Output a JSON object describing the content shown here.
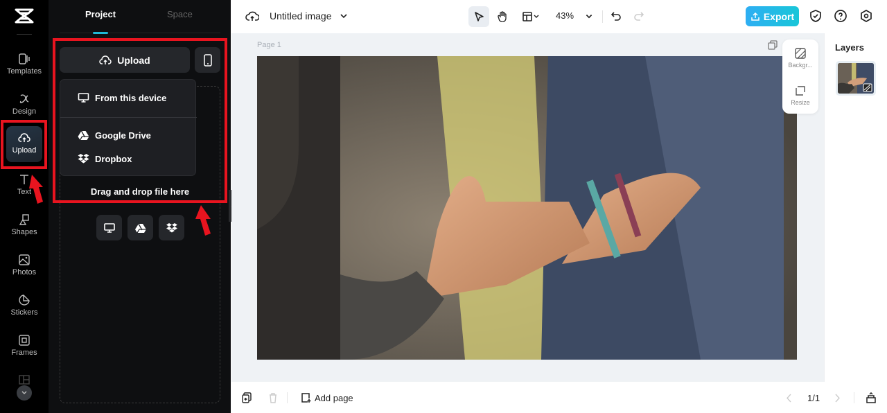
{
  "rail": {
    "items": [
      {
        "label": "Templates",
        "icon": "templates-icon"
      },
      {
        "label": "Design",
        "icon": "design-icon"
      },
      {
        "label": "Upload",
        "icon": "upload-cloud-icon",
        "active": true
      },
      {
        "label": "Text",
        "icon": "text-icon"
      },
      {
        "label": "Shapes",
        "icon": "shapes-icon"
      },
      {
        "label": "Photos",
        "icon": "photos-icon"
      },
      {
        "label": "Stickers",
        "icon": "stickers-icon"
      },
      {
        "label": "Frames",
        "icon": "frames-icon"
      }
    ]
  },
  "panel": {
    "tabs": [
      {
        "label": "Project",
        "active": true
      },
      {
        "label": "Space"
      }
    ],
    "upload_label": "Upload",
    "menu": [
      {
        "label": "From this device",
        "icon": "monitor-icon"
      },
      {
        "label": "Google Drive",
        "icon": "google-drive-icon"
      },
      {
        "label": "Dropbox",
        "icon": "dropbox-icon"
      }
    ],
    "drag_text": "Drag and drop file here"
  },
  "topbar": {
    "title": "Untitled image",
    "zoom": "43%",
    "export_label": "Export"
  },
  "canvas": {
    "page_label": "Page 1",
    "float_items": [
      {
        "label": "Backgr..."
      },
      {
        "label": "Resize"
      }
    ]
  },
  "layers": {
    "title": "Layers"
  },
  "bottom": {
    "add_page": "Add page",
    "pagination": "1/1"
  },
  "colors": {
    "accent": "#1fb8d6",
    "annotation": "#e8141f"
  }
}
